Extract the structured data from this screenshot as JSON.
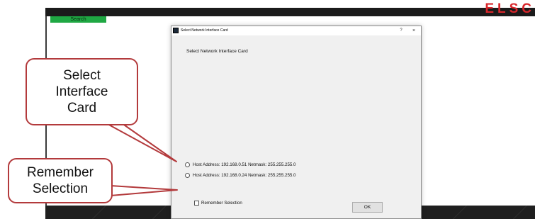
{
  "app": {
    "search_tab_label": "Search",
    "brand_text": "ELSC"
  },
  "dialog": {
    "title": "Select Network Interface Card",
    "help_label": "?",
    "close_label": "×",
    "heading": "Select Network Interface Card",
    "nic_options": [
      {
        "label": "Host Address: 192.168.0.51   Netmask: 255.255.255.0",
        "selected": false
      },
      {
        "label": "Host Address: 192.168.0.24   Netmask: 255.255.255.0",
        "selected": false
      }
    ],
    "remember_label": "Remember Selection",
    "remember_checked": false,
    "ok_label": "OK"
  },
  "callouts": {
    "card": [
      "Select",
      "Interface",
      "Card"
    ],
    "remember": [
      "Remember",
      "Selection"
    ]
  },
  "colors": {
    "callout_border": "#b33a3c",
    "tab_green": "#1fa843",
    "brand_red": "#d8262b"
  }
}
